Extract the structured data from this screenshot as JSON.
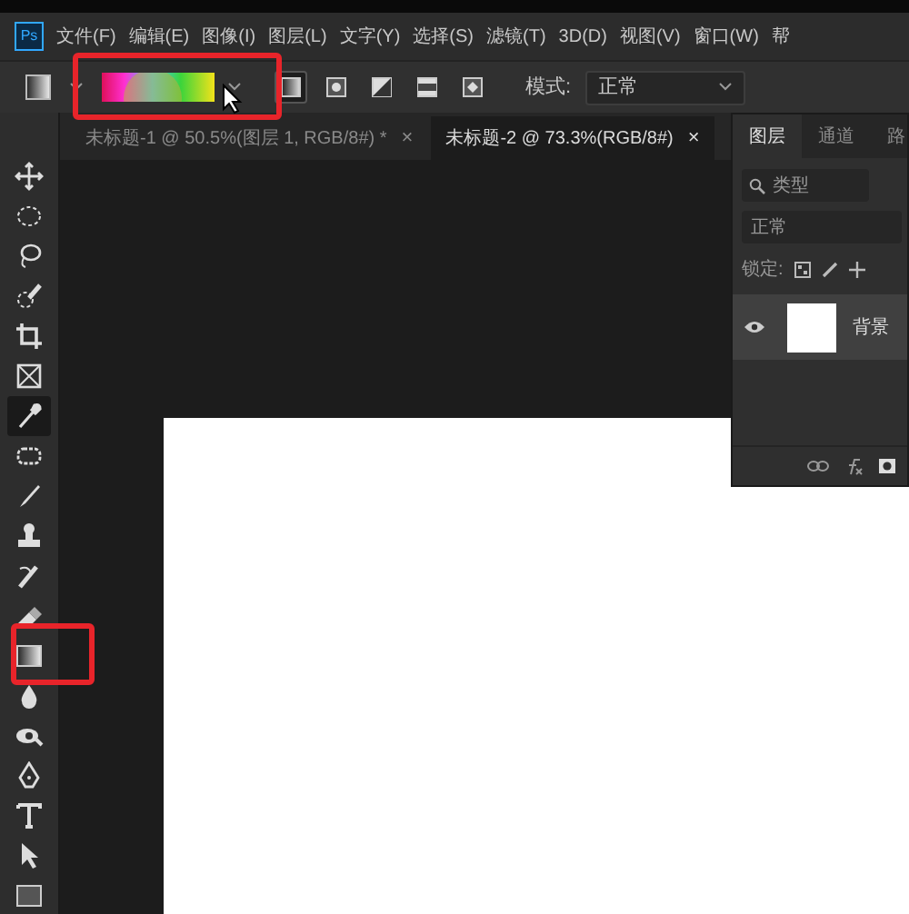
{
  "app": {
    "logo": "Ps"
  },
  "menu": [
    "文件(F)",
    "编辑(E)",
    "图像(I)",
    "图层(L)",
    "文字(Y)",
    "选择(S)",
    "滤镜(T)",
    "3D(D)",
    "视图(V)",
    "窗口(W)",
    "帮"
  ],
  "options": {
    "gradient_types": [
      {
        "kind": "linear",
        "selected": true
      },
      {
        "kind": "radial",
        "selected": false
      },
      {
        "kind": "angle",
        "selected": false
      },
      {
        "kind": "reflected",
        "selected": false
      },
      {
        "kind": "diamond",
        "selected": false
      }
    ],
    "mode_label": "模式:",
    "mode_value": "正常"
  },
  "doc_tabs": [
    {
      "title": "未标题-1 @ 50.5%(图层 1, RGB/8#) *",
      "close": "×",
      "selected": false
    },
    {
      "title": "未标题-2 @ 73.3%(RGB/8#)",
      "close": "×",
      "selected": true
    }
  ],
  "tools": [
    {
      "kind": "move",
      "selected": false
    },
    {
      "kind": "marquee",
      "selected": false
    },
    {
      "kind": "lasso",
      "selected": false
    },
    {
      "kind": "quick-select",
      "selected": false
    },
    {
      "kind": "crop",
      "selected": false
    },
    {
      "kind": "frame",
      "selected": false
    },
    {
      "kind": "eyedropper",
      "selected": true
    },
    {
      "kind": "healing",
      "selected": false
    },
    {
      "kind": "brush",
      "selected": false
    },
    {
      "kind": "stamp",
      "selected": false
    },
    {
      "kind": "history",
      "selected": false
    },
    {
      "kind": "eraser",
      "selected": false
    },
    {
      "kind": "gradient",
      "selected": false
    },
    {
      "kind": "blur",
      "selected": false
    },
    {
      "kind": "dodge",
      "selected": false
    },
    {
      "kind": "pen",
      "selected": false
    },
    {
      "kind": "type",
      "selected": false
    },
    {
      "kind": "path-select",
      "selected": false
    },
    {
      "kind": "shape",
      "selected": false
    }
  ],
  "layers_panel": {
    "tabs": [
      {
        "label": "图层",
        "selected": true
      },
      {
        "label": "通道",
        "selected": false
      },
      {
        "label": "路",
        "selected": false
      }
    ],
    "filter": "类型",
    "blend": "正常",
    "lock_label": "锁定:",
    "layers": [
      {
        "name": "背景",
        "visible": true,
        "selected": true
      }
    ]
  }
}
